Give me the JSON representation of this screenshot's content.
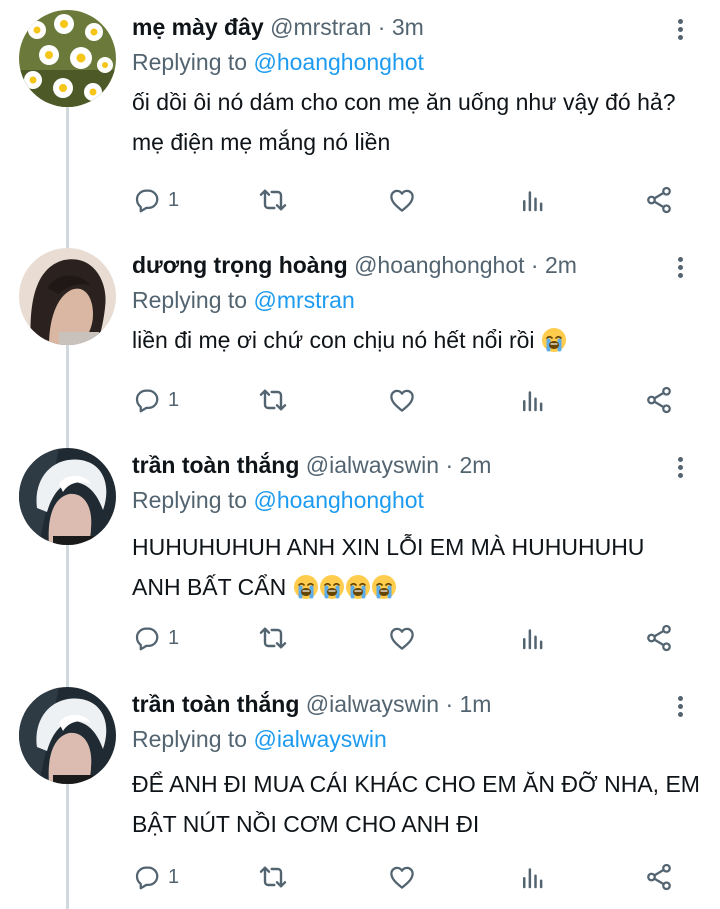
{
  "tweets": [
    {
      "name": "mẹ mày đây",
      "handle": "@mrstran",
      "separator": "·",
      "time": "3m",
      "replying_label": "Replying to",
      "replying_to": "@hoanghonghot",
      "text": "ối dồi ôi nó dám cho con mẹ ăn uống như vậy đó hả? mẹ điện mẹ mắng nó liền",
      "reply_count": "1",
      "avatar": "daisy-flowers"
    },
    {
      "name": "dương trọng hoàng",
      "handle": "@hoanghonghot",
      "separator": "·",
      "time": "2m",
      "replying_label": "Replying to",
      "replying_to": "@mrstran",
      "text": "liền đi mẹ ơi chứ con chịu nó hết nổi rồi",
      "emoji_count": 1,
      "reply_count": "1",
      "avatar": "dark-hair-person"
    },
    {
      "name": "trần toàn thắng",
      "handle": "@ialwayswin",
      "separator": "·",
      "time": "2m",
      "replying_label": "Replying to",
      "replying_to": "@hoanghonghot",
      "text_line1": "HUHUHUHUH ANH XIN LỖI EM MÀ HUHUHUHU",
      "text_line2": "ANH BẤT CẨN",
      "emoji_count": 4,
      "reply_count": "1",
      "avatar": "white-hair-person"
    },
    {
      "name": "trần toàn thắng",
      "handle": "@ialwayswin",
      "separator": "·",
      "time": "1m",
      "replying_label": "Replying to",
      "replying_to": "@ialwayswin",
      "text": "ĐỂ ANH ĐI MUA CÁI KHÁC CHO EM ĂN ĐỠ NHA, EM BẬT NÚT NỒI CƠM CHO ANH ĐI",
      "reply_count": "1",
      "avatar": "white-hair-person"
    }
  ],
  "colors": {
    "link": "#1d9bf0",
    "secondary": "#536471",
    "text": "#0f1419",
    "thread_line": "#cfd9de"
  },
  "icons": [
    "reply-icon",
    "retweet-icon",
    "like-icon",
    "views-icon",
    "share-icon",
    "more-icon",
    "loudly-crying-face-emoji"
  ]
}
